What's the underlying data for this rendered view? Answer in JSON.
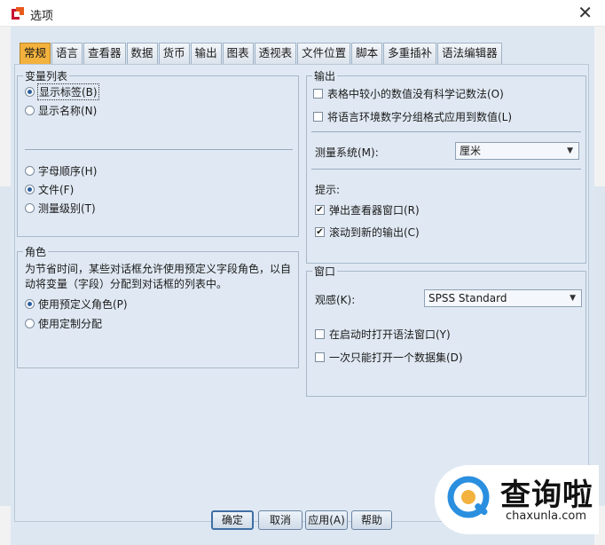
{
  "window": {
    "title": "选项"
  },
  "tabs": [
    "常规",
    "语言",
    "查看器",
    "数据",
    "货币",
    "输出",
    "图表",
    "透视表",
    "文件位置",
    "脚本",
    "多重插补",
    "语法编辑器"
  ],
  "variable_list": {
    "legend": "变量列表",
    "display_options": [
      {
        "label": "显示标签(B)",
        "selected": true
      },
      {
        "label": "显示名称(N)",
        "selected": false
      }
    ],
    "order_options": [
      {
        "label": "字母顺序(H)",
        "selected": false
      },
      {
        "label": "文件(F)",
        "selected": true
      },
      {
        "label": "测量级别(T)",
        "selected": false
      }
    ]
  },
  "roles": {
    "legend": "角色",
    "description": "为节省时间，某些对话框允许使用预定义字段角色，以自动将变量（字段）分配到对话框的列表中。",
    "options": [
      {
        "label": "使用预定义角色(P)",
        "selected": true
      },
      {
        "label": "使用定制分配",
        "selected": false
      }
    ]
  },
  "output": {
    "legend": "输出",
    "checks": [
      {
        "label": "表格中较小的数值没有科学记数法(O)",
        "checked": false
      },
      {
        "label": "将语言环境数字分组格式应用到数值(L)",
        "checked": false
      }
    ],
    "measurement_label": "测量系统(M):",
    "measurement_value": "厘米",
    "notify_label": "提示:",
    "notify_checks": [
      {
        "label": "弹出查看器窗口(R)",
        "checked": true
      },
      {
        "label": "滚动到新的输出(C)",
        "checked": true
      }
    ]
  },
  "window_group": {
    "legend": "窗口",
    "look_label": "观感(K):",
    "look_value": "SPSS Standard",
    "checks": [
      {
        "label": "在启动时打开语法窗口(Y)",
        "checked": false
      },
      {
        "label": "一次只能打开一个数据集(D)",
        "checked": false
      }
    ]
  },
  "buttons": {
    "ok": "确定",
    "cancel": "取消",
    "apply": "应用(A)",
    "help": "帮助"
  },
  "watermark": {
    "brand": "查询啦",
    "domain": "chaxunla.com"
  },
  "colors": {
    "active_tab": "#f3b23d",
    "dialog_bg": "#dde7f2",
    "watermark_blue": "#2b8fe0"
  }
}
